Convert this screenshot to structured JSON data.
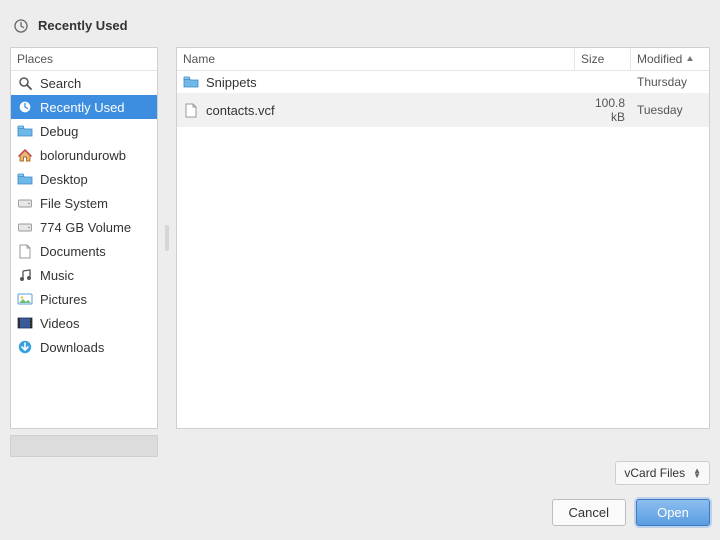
{
  "header": {
    "title": "Recently Used"
  },
  "sidebar": {
    "header": "Places",
    "items": [
      {
        "icon": "search",
        "label": "Search"
      },
      {
        "icon": "clock",
        "label": "Recently Used",
        "selected": true
      },
      {
        "icon": "folder",
        "label": "Debug"
      },
      {
        "icon": "home",
        "label": "bolorundurowb"
      },
      {
        "icon": "folder",
        "label": "Desktop"
      },
      {
        "icon": "drive",
        "label": "File System"
      },
      {
        "icon": "drive",
        "label": "774 GB Volume"
      },
      {
        "icon": "doc",
        "label": "Documents"
      },
      {
        "icon": "music",
        "label": "Music"
      },
      {
        "icon": "pictures",
        "label": "Pictures"
      },
      {
        "icon": "video",
        "label": "Videos"
      },
      {
        "icon": "download",
        "label": "Downloads"
      }
    ]
  },
  "files": {
    "columns": {
      "name": "Name",
      "size": "Size",
      "modified": "Modified"
    },
    "rows": [
      {
        "icon": "folder",
        "name": "Snippets",
        "size": "",
        "modified": "Thursday",
        "selected": false
      },
      {
        "icon": "doc",
        "name": "contacts.vcf",
        "size": "100.8 kB",
        "modified": "Tuesday",
        "selected": true
      }
    ]
  },
  "filter": {
    "label": "vCard Files"
  },
  "buttons": {
    "cancel": "Cancel",
    "open": "Open"
  }
}
